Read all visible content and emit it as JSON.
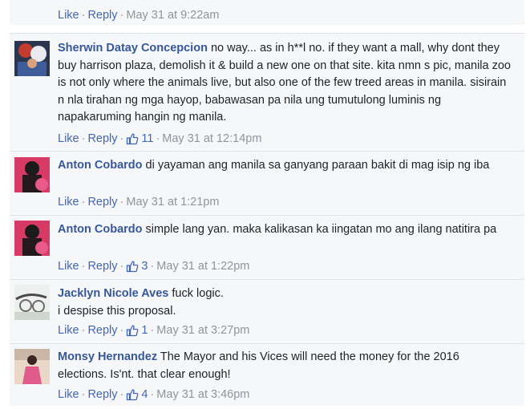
{
  "partial": {
    "actions": {
      "like": "Like",
      "reply": "Reply",
      "time": "May 31 at 9:22am"
    }
  },
  "comments": [
    {
      "author": "Sherwin Datay Concepcion",
      "text": "no way... as in h**l no. if they want a mall, why dont they buy harrison plaza, demolish it & build a new one on that site. kita nmn s pic, manila zoo is not only where the animals live, but also one of the few treed areas in manila. sisirain n nla tirahan ng mga hayop, babawasan pa nila ung tumutulong luminis ng napakaruming hangin ng manila.",
      "like": "Like",
      "reply": "Reply",
      "likes": "11",
      "time": "May 31 at 12:14pm",
      "avatar_icon": "profile-photo"
    },
    {
      "author": "Anton Cobardo",
      "text": "di yayaman ang manila sa ganyang paraan bakit di mag isip ng iba",
      "like": "Like",
      "reply": "Reply",
      "likes": "",
      "time": "May 31 at 1:21pm",
      "avatar_icon": "profile-photo"
    },
    {
      "author": "Anton Cobardo",
      "text": "simple lang yan. maka kalikasan ka iingatan mo ang ilang natitira pa",
      "like": "Like",
      "reply": "Reply",
      "likes": "3",
      "time": "May 31 at 1:22pm",
      "avatar_icon": "profile-photo"
    },
    {
      "author": "Jacklyn Nicole Aves",
      "text": "fuck logic.\ni despise this proposal.",
      "like": "Like",
      "reply": "Reply",
      "likes": "1",
      "time": "May 31 at 3:27pm",
      "avatar_icon": "profile-photo"
    },
    {
      "author": "Monsy Hernandez",
      "text": "The Mayor and his Vices will need the money for the 2016 elections. Is'nt. that clear enough!",
      "like": "Like",
      "reply": "Reply",
      "likes": "4",
      "time": "May 31 at 3:46pm",
      "avatar_icon": "profile-photo"
    }
  ],
  "colors": {
    "author": "#365899",
    "link": "#4267b2",
    "meta": "#90949c",
    "text": "#1d2129",
    "panel": "#f6f7f9",
    "separator": "#e1e2e6"
  },
  "icons": {
    "like_count": "thumbs-up-icon"
  }
}
